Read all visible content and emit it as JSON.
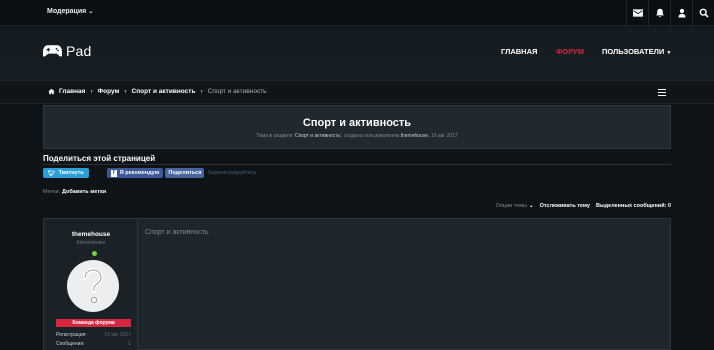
{
  "topbar": {
    "moderation_label": "Модерация",
    "icons": [
      "envelope-icon",
      "bell-icon",
      "user-icon",
      "search-icon"
    ]
  },
  "header": {
    "logo_text": "Pad",
    "logo_icon": "gamepad-icon",
    "nav": [
      {
        "label": "ГЛАВНАЯ",
        "active": false
      },
      {
        "label": "ФОРУМ",
        "active": true
      },
      {
        "label": "ПОЛЬЗОВАТЕЛИ",
        "active": false
      }
    ],
    "active_color": "#d7263f"
  },
  "breadcrumb": {
    "home": "Главная",
    "forum": "Форум",
    "category": "Спорт и активность",
    "current": "Спорт и активность"
  },
  "thread": {
    "title": "Спорт и активность",
    "desc_prefix": "Тема в разделе '",
    "desc_section": "Спорт и активность",
    "desc_mid": "', создана пользователем",
    "desc_author": "themehouse",
    "desc_date": "19 авг 2017"
  },
  "share": {
    "title": "Поделиться этой страницей",
    "tweet": "Твитнуть",
    "fb_recommend": "Я рекомендую",
    "fb_share": "Поделиться",
    "fb_hint": "Зарегистрируйтесь"
  },
  "tags": {
    "label": "Метки:",
    "add": "Добавить метки"
  },
  "thread_tools": {
    "options": "Опции темы",
    "watch": "Отслеживать тему",
    "selected": "Выделенных сообщений: 0"
  },
  "post": {
    "username": "themehouse",
    "user_title": "Administrator",
    "banner": "Команда форума",
    "stats": [
      {
        "key": "Регистрация:",
        "value": "19 авг 2017"
      },
      {
        "key": "Сообщения:",
        "value": "1"
      }
    ],
    "body": "Спорт и активность"
  }
}
